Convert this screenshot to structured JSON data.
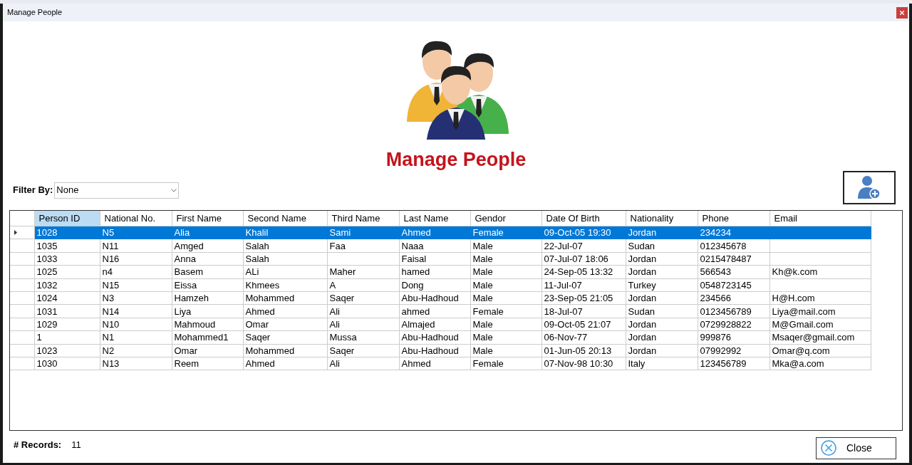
{
  "window": {
    "title": "Manage People"
  },
  "heading": "Manage People",
  "filter": {
    "label": "Filter By:",
    "value": "None"
  },
  "table": {
    "columns": [
      {
        "label": "Person ID",
        "highlighted": true
      },
      {
        "label": "National No.",
        "highlighted": false
      },
      {
        "label": "First Name",
        "highlighted": false
      },
      {
        "label": "Second Name",
        "highlighted": false
      },
      {
        "label": "Third Name",
        "highlighted": false
      },
      {
        "label": "Last Name",
        "highlighted": false
      },
      {
        "label": "Gendor",
        "highlighted": false
      },
      {
        "label": "Date Of Birth",
        "highlighted": false
      },
      {
        "label": "Nationality",
        "highlighted": false
      },
      {
        "label": "Phone",
        "highlighted": false
      },
      {
        "label": "Email",
        "highlighted": false
      }
    ],
    "rows": [
      {
        "selected": true,
        "cells": [
          "1028",
          "N5",
          "Alia",
          "Khalil",
          "Sami",
          "Ahmed",
          "Female",
          "09-Oct-05 19:30",
          "Jordan",
          "234234",
          ""
        ]
      },
      {
        "selected": false,
        "cells": [
          "1035",
          "N11",
          "Amged",
          "Salah",
          "Faa",
          "Naaa",
          "Male",
          "22-Jul-07",
          "Sudan",
          "012345678",
          ""
        ]
      },
      {
        "selected": false,
        "cells": [
          "1033",
          "N16",
          "Anna",
          "Salah",
          "",
          "Faisal",
          "Male",
          "07-Jul-07 18:06",
          "Jordan",
          "0215478487",
          ""
        ]
      },
      {
        "selected": false,
        "cells": [
          "1025",
          "n4",
          "Basem",
          "ALi",
          "Maher",
          "hamed",
          "Male",
          "24-Sep-05 13:32",
          "Jordan",
          "566543",
          "Kh@k.com"
        ]
      },
      {
        "selected": false,
        "cells": [
          "1032",
          "N15",
          "Eissa",
          "Khmees",
          "A",
          "Dong",
          "Male",
          "11-Jul-07",
          "Turkey",
          "0548723145",
          ""
        ]
      },
      {
        "selected": false,
        "cells": [
          "1024",
          "N3",
          "Hamzeh",
          "Mohammed",
          "Saqer",
          "Abu-Hadhoud",
          "Male",
          "23-Sep-05 21:05",
          "Jordan",
          "234566",
          "H@H.com"
        ]
      },
      {
        "selected": false,
        "cells": [
          "1031",
          "N14",
          "Liya",
          "Ahmed",
          "Ali",
          "ahmed",
          "Female",
          "18-Jul-07",
          "Sudan",
          "0123456789",
          "Liya@mail.com"
        ]
      },
      {
        "selected": false,
        "cells": [
          "1029",
          "N10",
          "Mahmoud",
          "Omar",
          "Ali",
          "Almajed",
          "Male",
          "09-Oct-05 21:07",
          "Jordan",
          "0729928822",
          "M@Gmail.com"
        ]
      },
      {
        "selected": false,
        "cells": [
          "1",
          "N1",
          "Mohammed1",
          "Saqer",
          "Mussa",
          "Abu-Hadhoud",
          "Male",
          "06-Nov-77",
          "Jordan",
          "999876",
          "Msaqer@gmail.com"
        ]
      },
      {
        "selected": false,
        "cells": [
          "1023",
          "N2",
          "Omar",
          "Mohammed",
          "Saqer",
          "Abu-Hadhoud",
          "Male",
          "01-Jun-05 20:13",
          "Jordan",
          "07992992",
          "Omar@q.com"
        ]
      },
      {
        "selected": false,
        "cells": [
          "1030",
          "N13",
          "Reem",
          "Ahmed",
          "Ali",
          "Ahmed",
          "Female",
          "07-Nov-98 10:30",
          "Italy",
          "123456789",
          "Mka@a.com"
        ]
      }
    ]
  },
  "records": {
    "label": "# Records:",
    "value": "11"
  },
  "close_button": "Close"
}
